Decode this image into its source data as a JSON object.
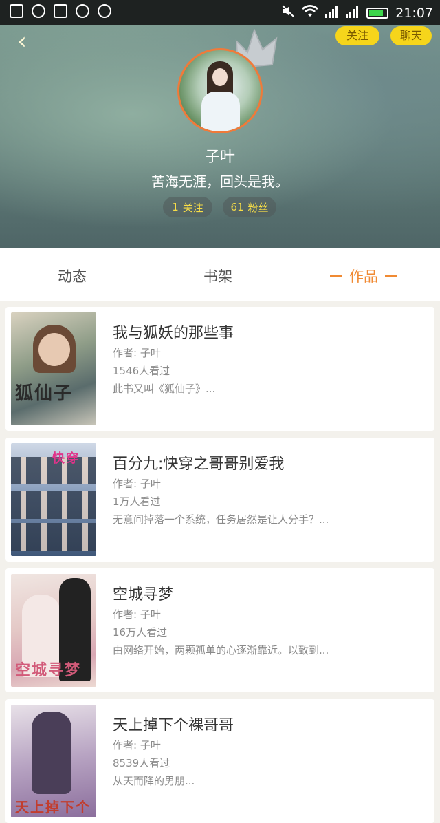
{
  "status_bar": {
    "time": "21:07",
    "left_icons": [
      "notes-icon",
      "chat-icon",
      "image-icon",
      "camera-icon",
      "more-icon"
    ],
    "right_icons": [
      "mute-icon",
      "wifi-icon",
      "signal-icon",
      "signal-icon",
      "battery-icon"
    ]
  },
  "header": {
    "back_icon": "‹",
    "follow_label": "关注",
    "chat_label": "聊天",
    "username": "子叶",
    "signature": "苦海无涯，回头是我。",
    "following": {
      "count": "1",
      "label": "关注"
    },
    "fans": {
      "count": "61",
      "label": "粉丝"
    }
  },
  "tabs": [
    {
      "label": "动态"
    },
    {
      "label": "书架"
    },
    {
      "label": "作品"
    }
  ],
  "books": [
    {
      "title": "我与狐妖的那些事",
      "author": "作者: 子叶",
      "views": "1546人看过",
      "desc": "此书又叫《狐仙子》...",
      "cover_text": "狐仙子"
    },
    {
      "title": "百分九:快穿之哥哥别爱我",
      "author": "作者: 子叶",
      "views": "1万人看过",
      "desc": "无意间掉落一个系统，任务居然是让人分手？...",
      "cover_text": "快穿"
    },
    {
      "title": "空城寻梦",
      "author": "作者: 子叶",
      "views": "16万人看过",
      "desc": "由网络开始，两颗孤单的心逐渐靠近。以致到...",
      "cover_text": "空城寻梦"
    },
    {
      "title": "天上掉下个裸哥哥",
      "author": "作者: 子叶",
      "views": "8539人看过",
      "desc": "从天而降的男朋...",
      "cover_text": "天上掉下个"
    }
  ],
  "colors": {
    "accent": "#f08a33",
    "button_yellow": "#f6d51b",
    "stat_text": "#f7dd47"
  }
}
